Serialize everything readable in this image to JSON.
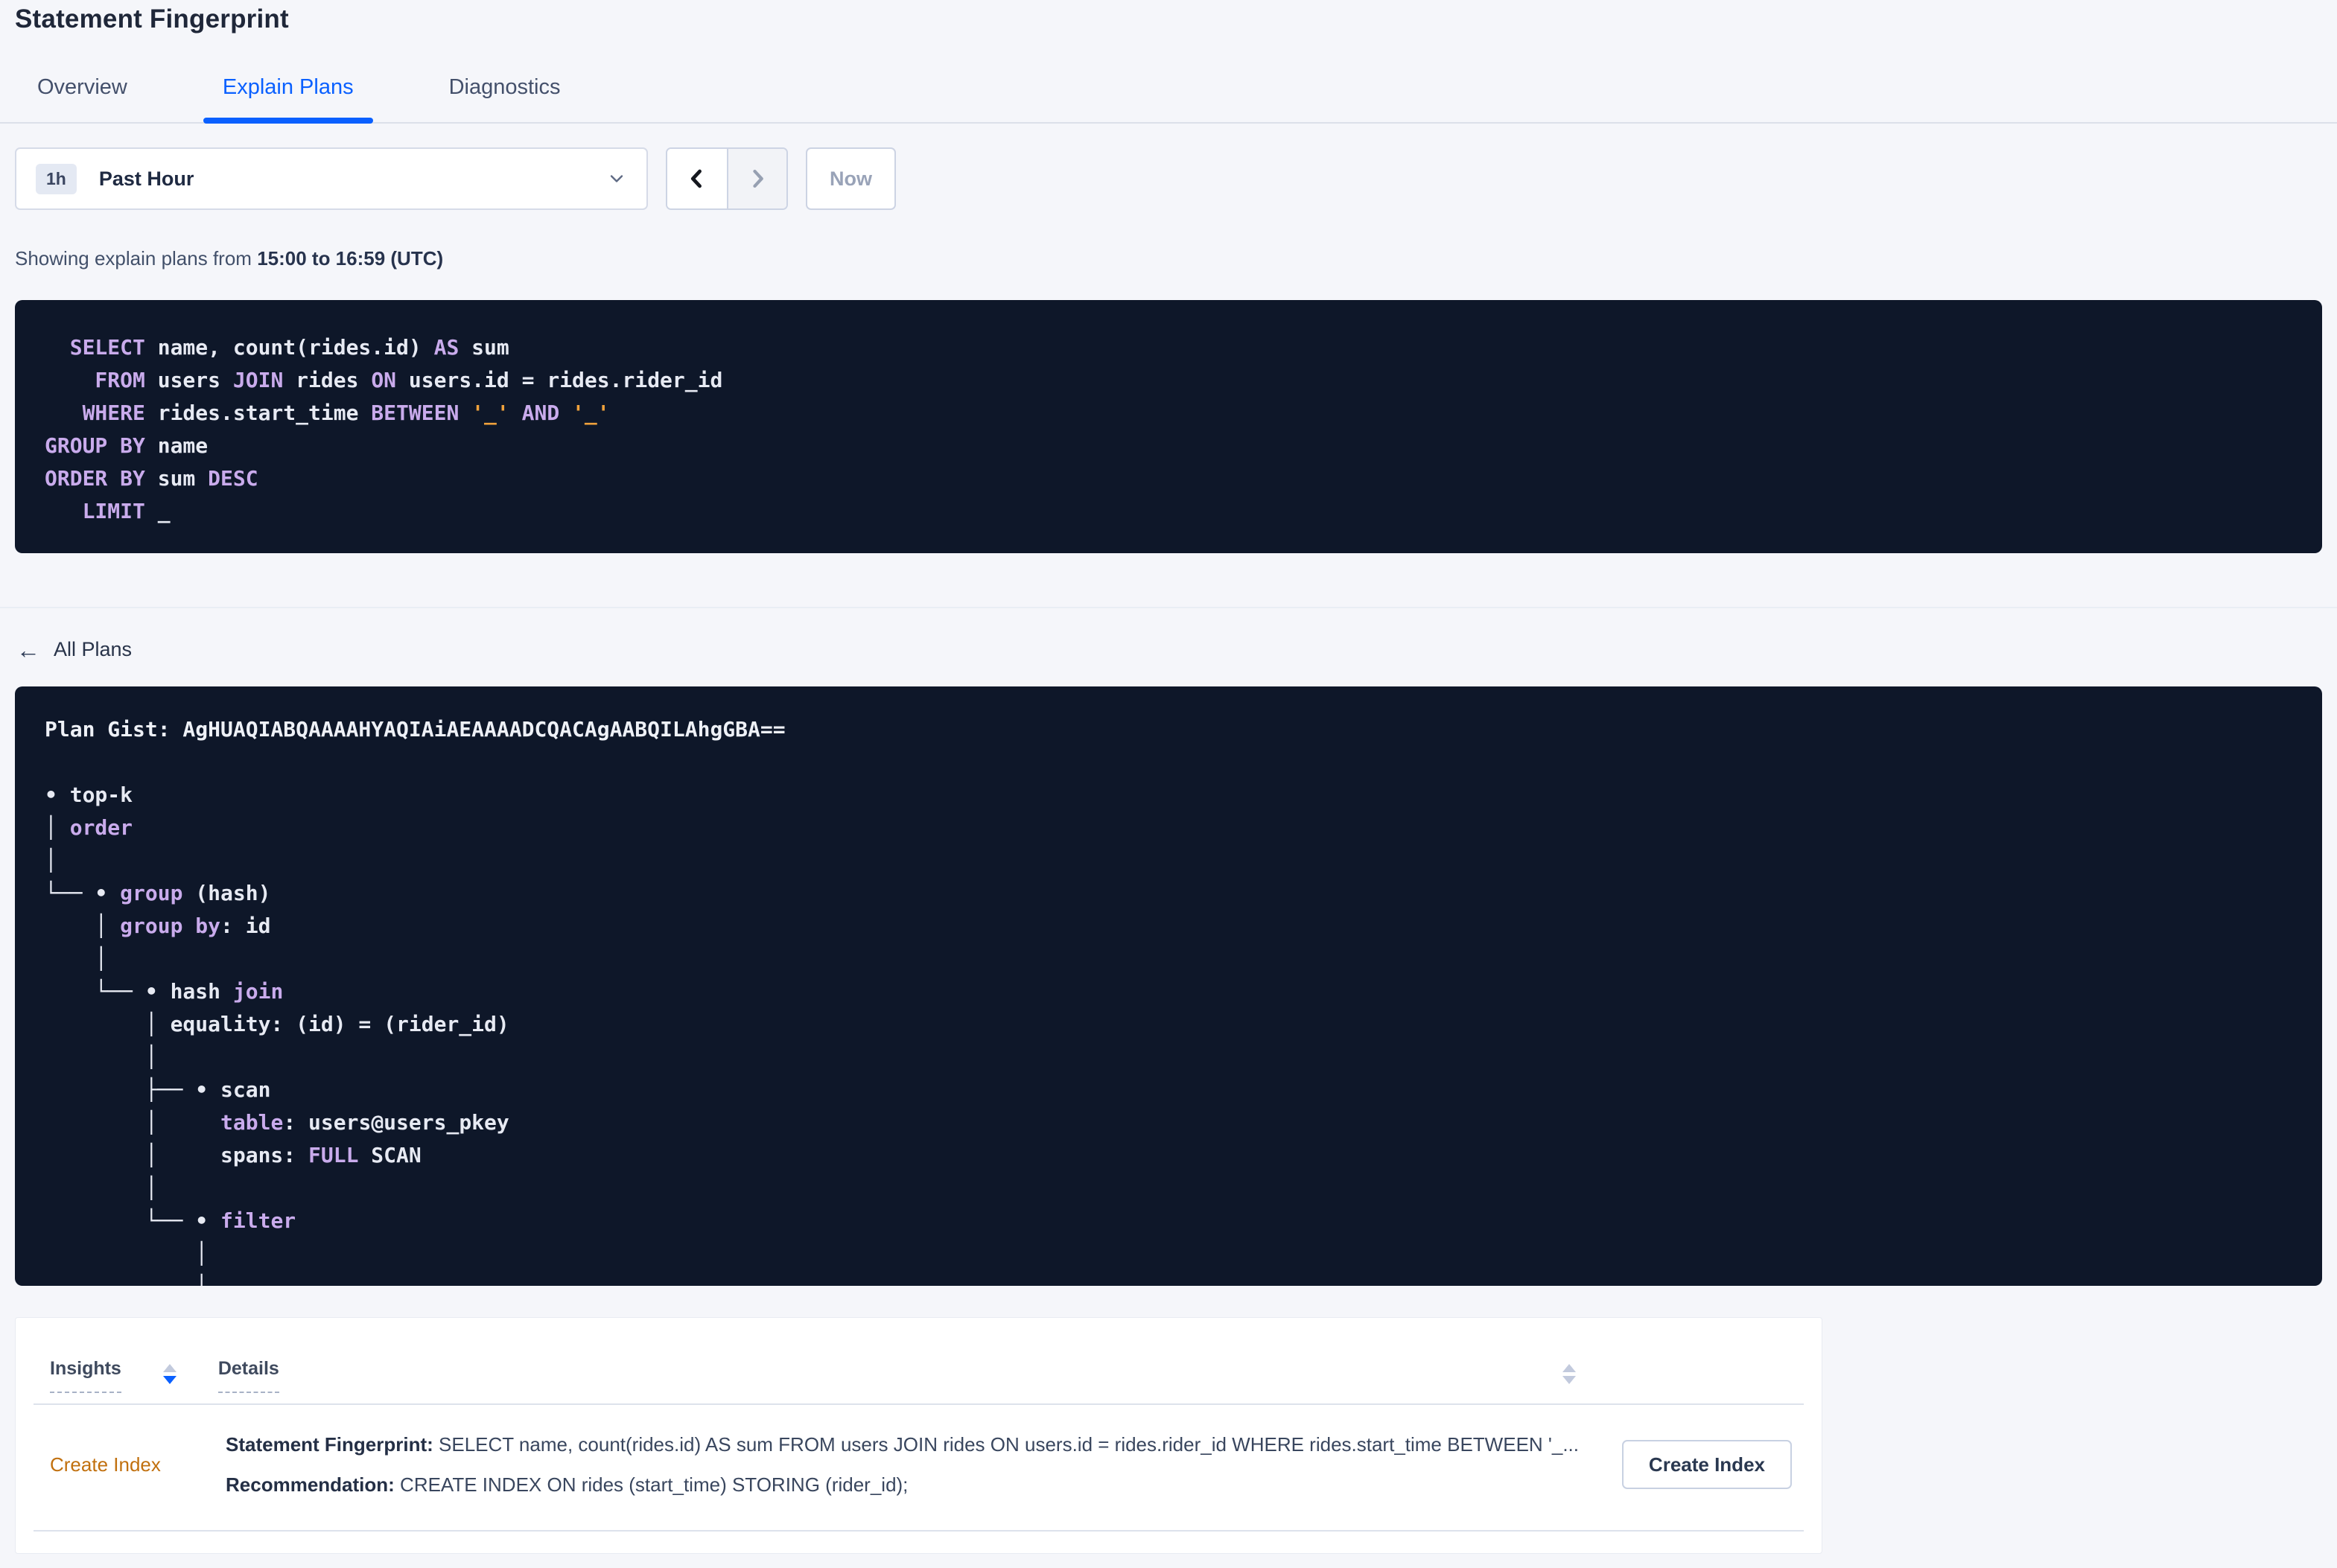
{
  "page_title": "Statement Fingerprint",
  "tabs": {
    "overview": "Overview",
    "explain_plans": "Explain Plans",
    "diagnostics": "Diagnostics"
  },
  "time_controls": {
    "badge": "1h",
    "label": "Past Hour",
    "now_label": "Now"
  },
  "showing": {
    "prefix": "Showing explain plans from ",
    "range": "15:00 to 16:59 (UTC)"
  },
  "sql_statement": {
    "lines": [
      [
        [
          "k",
          "  SELECT"
        ],
        [
          "w",
          " name, count(rides.id) "
        ],
        [
          "k",
          "AS"
        ],
        [
          "w",
          " sum"
        ]
      ],
      [
        [
          "k",
          "    FROM"
        ],
        [
          "w",
          " users "
        ],
        [
          "k",
          "JOIN"
        ],
        [
          "w",
          " rides "
        ],
        [
          "k",
          "ON"
        ],
        [
          "w",
          " users.id = rides.rider_id"
        ]
      ],
      [
        [
          "k",
          "   WHERE"
        ],
        [
          "w",
          " rides.start_time "
        ],
        [
          "k",
          "BETWEEN"
        ],
        [
          "w",
          " "
        ],
        [
          "s",
          "'_'"
        ],
        [
          "w",
          " "
        ],
        [
          "k",
          "AND"
        ],
        [
          "w",
          " "
        ],
        [
          "s",
          "'_'"
        ]
      ],
      [
        [
          "k",
          "GROUP BY"
        ],
        [
          "w",
          " name"
        ]
      ],
      [
        [
          "k",
          "ORDER BY"
        ],
        [
          "w",
          " sum "
        ],
        [
          "k",
          "DESC"
        ]
      ],
      [
        [
          "k",
          "   LIMIT"
        ],
        [
          "w",
          " _"
        ]
      ]
    ]
  },
  "all_plans": {
    "label": "All Plans"
  },
  "plan": {
    "lines": [
      [
        [
          "g",
          "Plan Gist: AgHUAQIABQAAAAHYAQIAiAEAAAADCQACAgAABQILAhgGBA=="
        ]
      ],
      [
        [
          "w",
          ""
        ]
      ],
      [
        [
          "w",
          "• top-k"
        ]
      ],
      [
        [
          "w",
          "│ "
        ],
        [
          "k",
          "order"
        ]
      ],
      [
        [
          "w",
          "│"
        ]
      ],
      [
        [
          "w",
          "└── • "
        ],
        [
          "k",
          "group"
        ],
        [
          "w",
          " (hash)"
        ]
      ],
      [
        [
          "w",
          "    │ "
        ],
        [
          "k",
          "group by"
        ],
        [
          "w",
          ": id"
        ]
      ],
      [
        [
          "w",
          "    │"
        ]
      ],
      [
        [
          "w",
          "    └── • hash "
        ],
        [
          "k",
          "join"
        ]
      ],
      [
        [
          "w",
          "        │ equality: (id) = (rider_id)"
        ]
      ],
      [
        [
          "w",
          "        │"
        ]
      ],
      [
        [
          "w",
          "        ├── • scan"
        ]
      ],
      [
        [
          "w",
          "        │     "
        ],
        [
          "k",
          "table"
        ],
        [
          "w",
          ": users@users_pkey"
        ]
      ],
      [
        [
          "w",
          "        │     spans: "
        ],
        [
          "k",
          "FULL"
        ],
        [
          "w",
          " SCAN"
        ]
      ],
      [
        [
          "w",
          "        │"
        ]
      ],
      [
        [
          "w",
          "        └── • "
        ],
        [
          "k",
          "filter"
        ]
      ],
      [
        [
          "w",
          "            │"
        ]
      ],
      [
        [
          "w",
          "            │"
        ]
      ]
    ]
  },
  "insights_table": {
    "columns": {
      "insights": "Insights",
      "details": "Details"
    },
    "row": {
      "insight_type": "Create Index",
      "fingerprint_label": "Statement Fingerprint:",
      "fingerprint_text": " SELECT name, count(rides.id) AS sum FROM users JOIN rides ON users.id = rides.rider_id WHERE rides.start_time BETWEEN '_...",
      "recommendation_label": "Recommendation:",
      "recommendation_text": " CREATE INDEX ON rides (start_time) STORING (rider_id);",
      "action_button": "Create Index"
    }
  },
  "colors": {
    "accent_blue": "#0a60ff",
    "code_background": "#0e1729",
    "code_keyword": "#c9abec",
    "code_literal": "#f0a23c",
    "insight_link": "#c1700e",
    "page_background": "#f5f6fa"
  }
}
